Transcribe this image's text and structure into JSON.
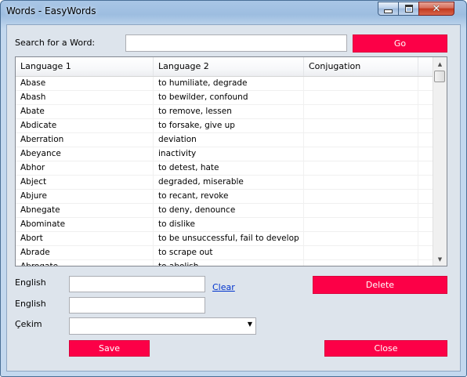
{
  "window": {
    "title": "Words - EasyWords"
  },
  "search": {
    "label": "Search for a Word:",
    "value": "",
    "go_label": "Go"
  },
  "grid": {
    "columns": [
      "Language 1",
      "Language 2",
      "Conjugation"
    ],
    "rows": [
      [
        "Abase",
        "to humiliate, degrade",
        ""
      ],
      [
        "Abash",
        "to bewilder, confound",
        ""
      ],
      [
        "Abate",
        "to remove, lessen",
        ""
      ],
      [
        "Abdicate",
        "to forsake, give up",
        ""
      ],
      [
        "Aberration",
        "deviation",
        ""
      ],
      [
        "Abeyance",
        "inactivity",
        ""
      ],
      [
        "Abhor",
        "to detest, hate",
        ""
      ],
      [
        "Abject",
        "degraded, miserable",
        ""
      ],
      [
        "Abjure",
        "to recant, revoke",
        ""
      ],
      [
        "Abnegate",
        "to deny, denounce",
        ""
      ],
      [
        "Abominate",
        "to dislike",
        ""
      ],
      [
        "Abort",
        "to be unsuccessful, fail to develop",
        ""
      ],
      [
        "Abrade",
        "to scrape out",
        ""
      ],
      [
        "Abrogate",
        "to abolish",
        ""
      ]
    ]
  },
  "form": {
    "field1_label": "English",
    "field1_value": "",
    "clear_label": "Clear",
    "field2_label": "English",
    "field2_value": "",
    "field3_label": "Çekim",
    "field3_value": ""
  },
  "buttons": {
    "delete_label": "Delete",
    "save_label": "Save",
    "close_label": "Close"
  },
  "colors": {
    "accent": "#fc0047",
    "link": "#0033cc"
  }
}
